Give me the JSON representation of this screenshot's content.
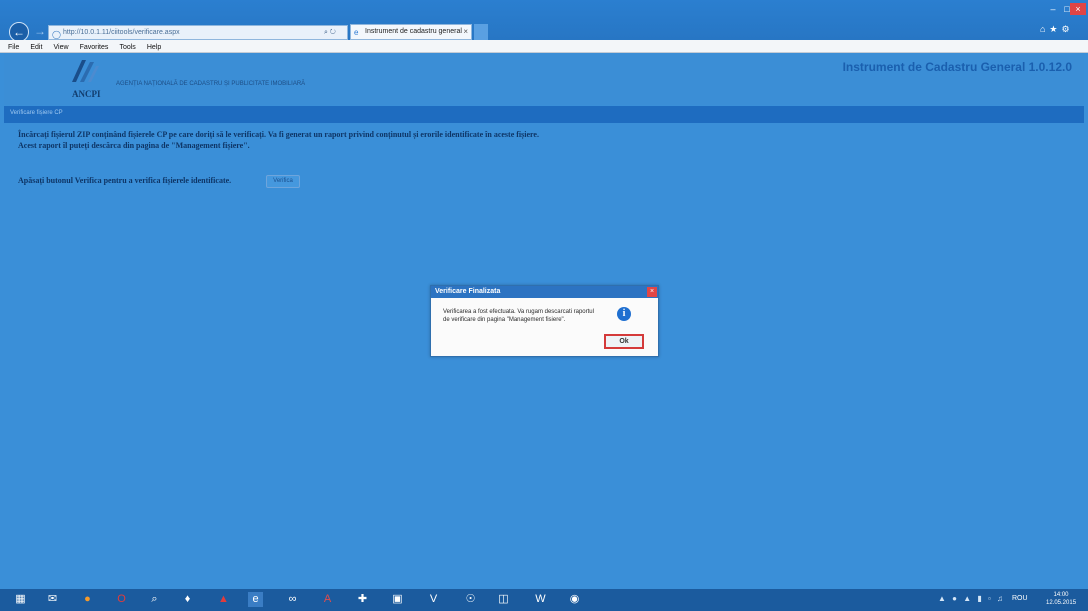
{
  "browser": {
    "address": "http://10.0.1.11/ciitools/verificare.aspx",
    "tab_title": "Instrument de cadastru general",
    "menu": [
      "File",
      "Edit",
      "View",
      "Favorites",
      "Tools",
      "Help"
    ]
  },
  "app": {
    "logo_text": "ANCPI",
    "agency_name": "AGENȚIA NAȚIONALĂ DE CADASTRU ȘI PUBLICITATE IMOBILIARĂ",
    "title": "Instrument de Cadastru General 1.0.12.0",
    "breadcrumb": "Verificare fișiere CP"
  },
  "content": {
    "instruction_line1": "Încărcați fișierul ZIP conținând fișierele CP pe care doriți să le verificați. Va fi generat un raport privind conținutul și erorile identificate în aceste fișiere.",
    "instruction_line2": "Acest raport îl puteți descărca din pagina de \"Management fișiere\".",
    "verify_prompt": "Apăsați butonul Verifica pentru a verifica fișierele identificate.",
    "verify_button": "Verifica"
  },
  "dialog": {
    "title": "Verificare Finalizata",
    "message": "Verificarea a fost efectuata. Va rugam descarcati raportul de verificare din pagina \"Management fisiere\".",
    "icon": "info-icon",
    "ok_label": "Ok"
  },
  "taskbar": {
    "icons": [
      "windows-start-icon",
      "outlook-icon",
      "firefox-icon",
      "opera-icon",
      "search-icon",
      "app-icon",
      "pdf-icon",
      "ie-icon",
      "network-icon",
      "access-icon",
      "plane-icon",
      "photo-icon",
      "visio-icon",
      "globe-icon",
      "files-icon",
      "word-icon",
      "chrome-icon"
    ],
    "language": "ROU",
    "time": "14:00",
    "date": "12.05.2015"
  },
  "colors": {
    "accent": "#3a8fd8",
    "nav": "#1e6cc0",
    "dialog_header": "#2c73c2",
    "ok_highlight": "#d43a3a"
  }
}
